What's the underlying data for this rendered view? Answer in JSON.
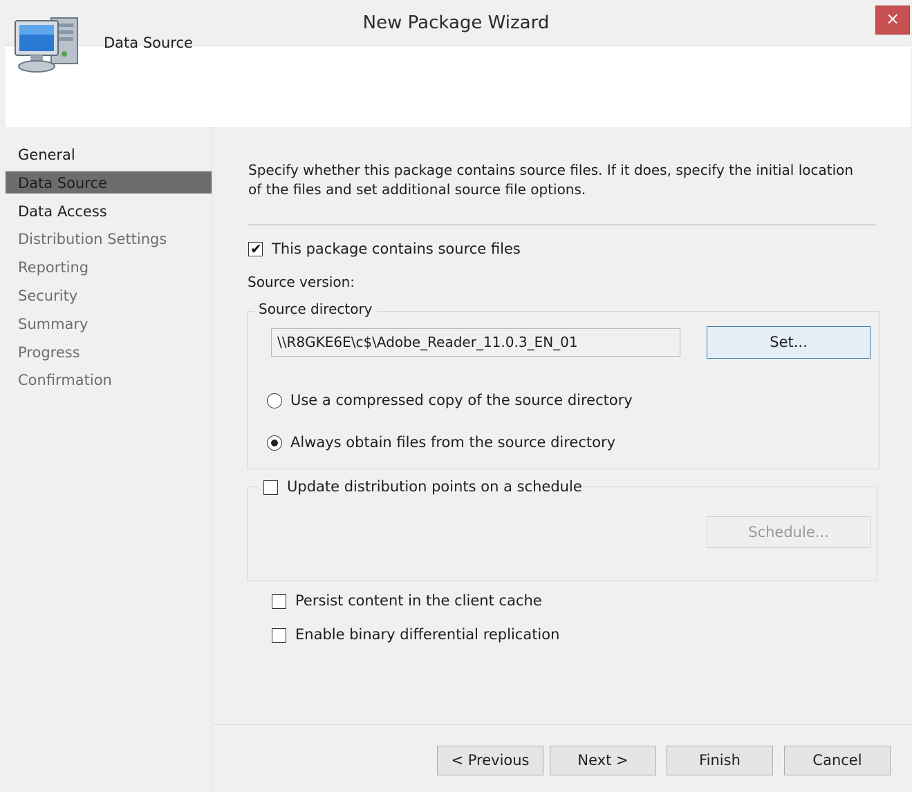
{
  "window": {
    "title": "New Package Wizard",
    "close_label": "×"
  },
  "header": {
    "title": "Data Source",
    "icon": "computer-icon"
  },
  "sidebar": {
    "items": [
      {
        "label": "General",
        "enabled": true
      },
      {
        "label": "Data Source",
        "enabled": true,
        "selected": true
      },
      {
        "label": "Data Access",
        "enabled": true
      },
      {
        "label": "Distribution Settings",
        "enabled": false
      },
      {
        "label": "Reporting",
        "enabled": false
      },
      {
        "label": "Security",
        "enabled": false
      },
      {
        "label": "Summary",
        "enabled": false
      },
      {
        "label": "Progress",
        "enabled": false
      },
      {
        "label": "Confirmation",
        "enabled": false
      }
    ]
  },
  "main": {
    "description": "Specify whether this package contains source files. If it does, specify the initial location of the files and set additional source file options.",
    "contains_source": {
      "label": "This package contains source files",
      "checked": true
    },
    "source_version_label": "Source version:",
    "source_directory": {
      "legend": "Source directory",
      "value": "\\\\R8GKE6E\\c$\\Adobe_Reader_11.0.3_EN_01",
      "set_button": "Set...",
      "options": [
        {
          "label": "Use a compressed copy of the source directory",
          "selected": false
        },
        {
          "label": "Always obtain files from the source directory",
          "selected": true
        }
      ]
    },
    "update_schedule": {
      "label": "Update distribution points on a schedule",
      "checked": false,
      "schedule_button": "Schedule..."
    },
    "persist_cache": {
      "label": "Persist content in the client cache",
      "checked": false
    },
    "binary_diff": {
      "label": "Enable binary differential replication",
      "checked": false
    }
  },
  "footer": {
    "previous": "< Previous",
    "next": "Next >",
    "finish": "Finish",
    "cancel": "Cancel"
  }
}
